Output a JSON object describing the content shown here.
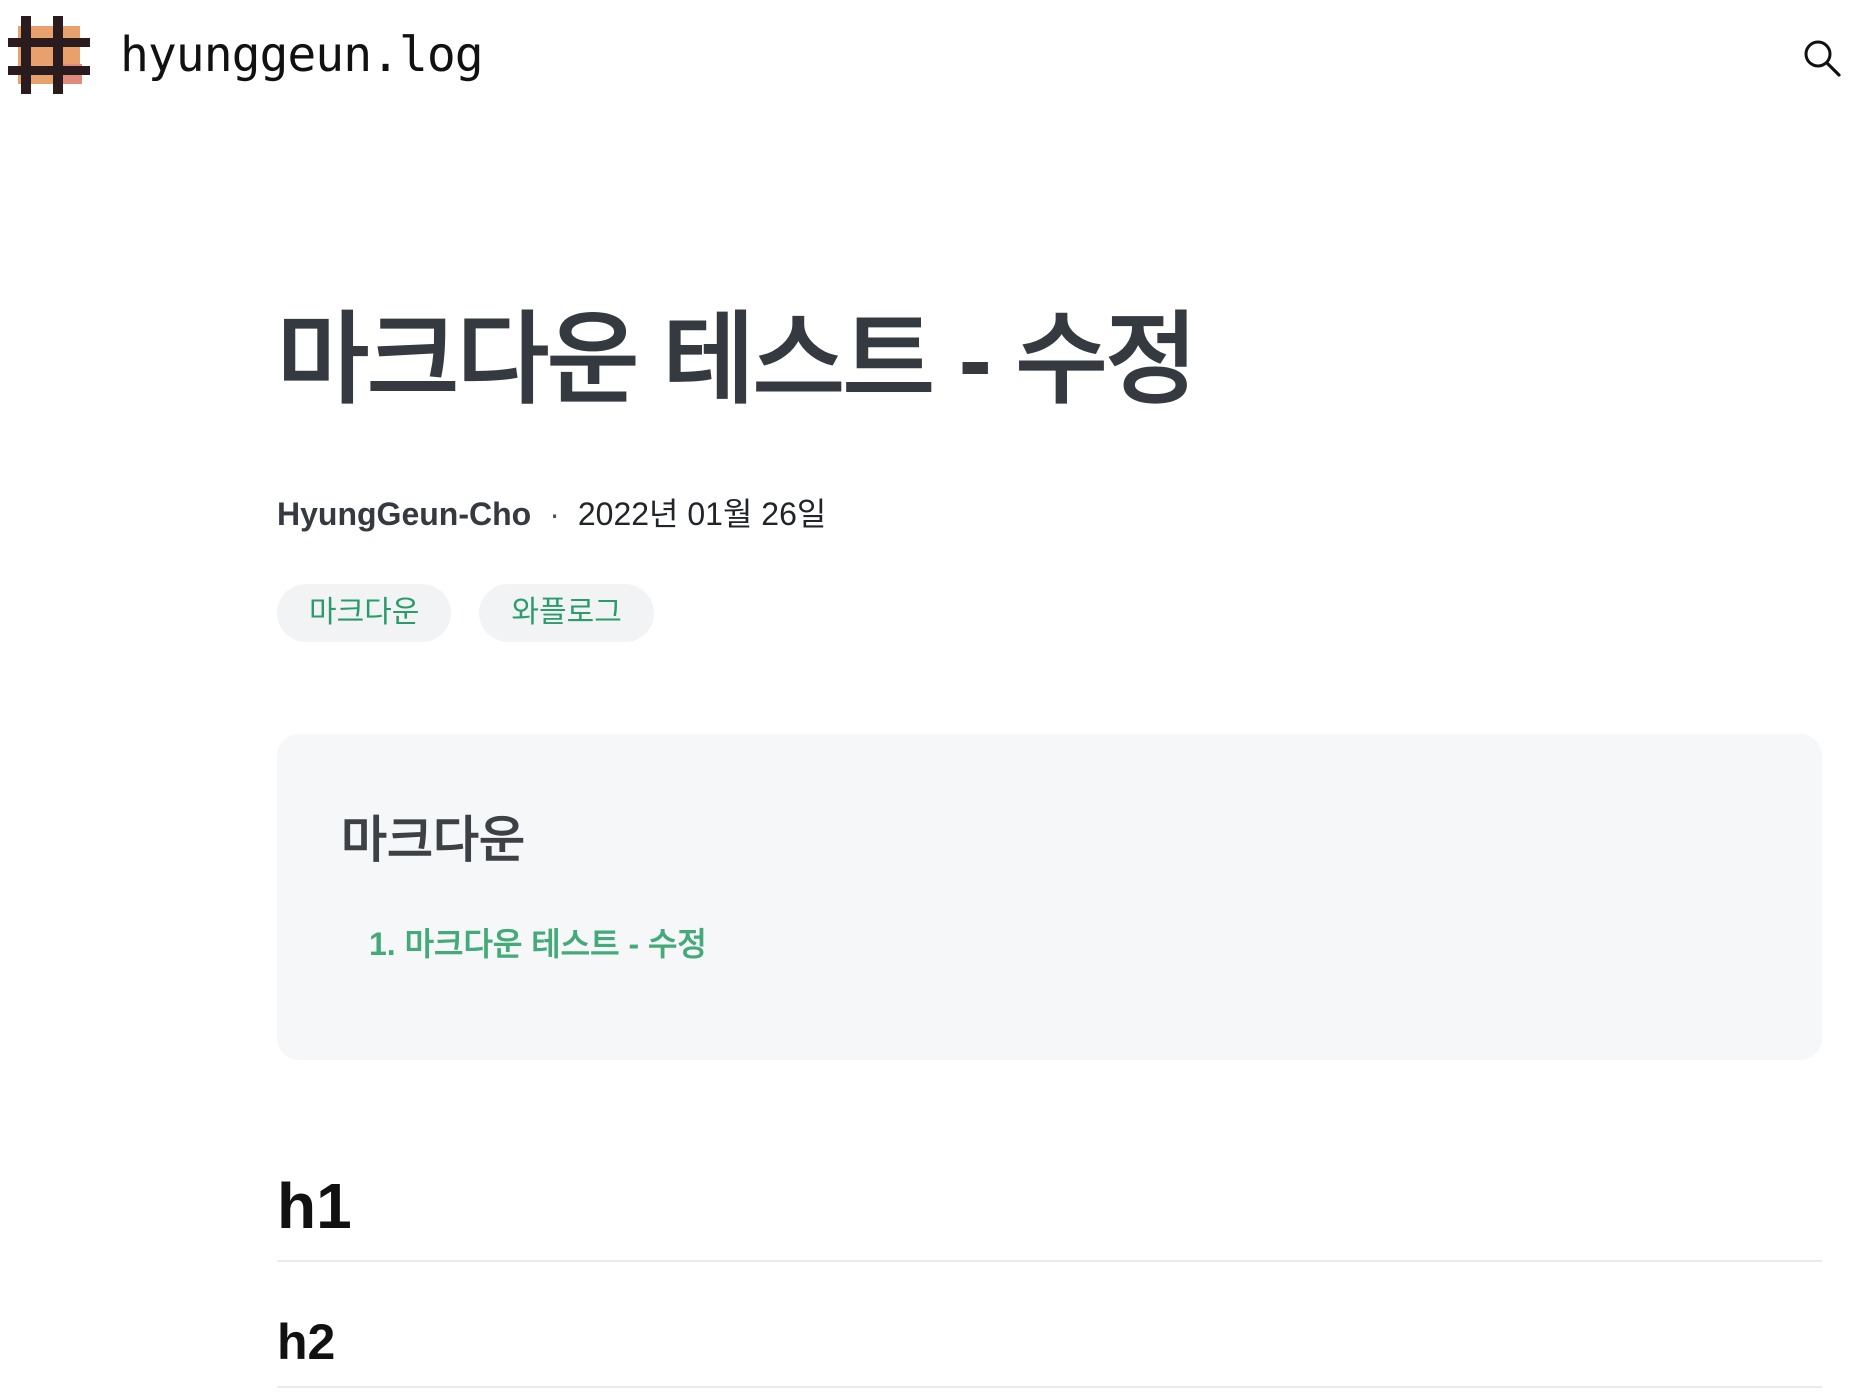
{
  "header": {
    "site_name": "hyunggeun.log",
    "logo_icon": "grid-logo-icon",
    "search_icon": "search-icon",
    "logo_colors": {
      "bars": "#2a1b1e",
      "orange": "#e8a06d",
      "salmon": "#e08a7b"
    }
  },
  "post": {
    "title": "마크다운 테스트 - 수정",
    "author": "HyungGeun-Cho",
    "separator": "·",
    "date": "2022년 01월 26일",
    "tags": [
      "마크다운",
      "와플로그"
    ]
  },
  "toc": {
    "title": "마크다운",
    "items": [
      "1. 마크다운 테스트 - 수정"
    ]
  },
  "body": {
    "h1": "h1",
    "h2": "h2"
  },
  "colors": {
    "accent": "#2b9b6a",
    "toc_link": "#45aa7a",
    "tag_bg": "#f1f3f5",
    "toc_bg": "#f6f7f9",
    "title_text": "#343a40"
  }
}
